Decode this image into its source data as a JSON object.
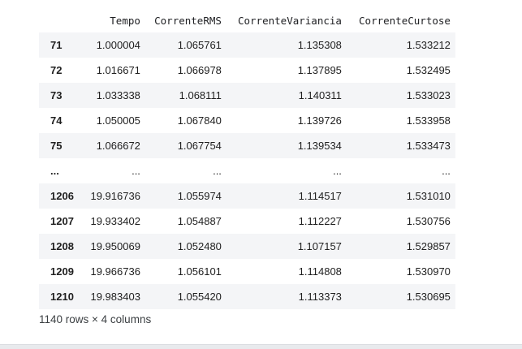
{
  "table": {
    "columns": [
      "Tempo",
      "CorrenteRMS",
      "CorrenteVariancia",
      "CorrenteCurtose"
    ],
    "rows": [
      {
        "index": "71",
        "values": [
          "1.000004",
          "1.065761",
          "1.135308",
          "1.533212"
        ]
      },
      {
        "index": "72",
        "values": [
          "1.016671",
          "1.066978",
          "1.137895",
          "1.532495"
        ]
      },
      {
        "index": "73",
        "values": [
          "1.033338",
          "1.068111",
          "1.140311",
          "1.533023"
        ]
      },
      {
        "index": "74",
        "values": [
          "1.050005",
          "1.067840",
          "1.139726",
          "1.533958"
        ]
      },
      {
        "index": "75",
        "values": [
          "1.066672",
          "1.067754",
          "1.139534",
          "1.533473"
        ]
      },
      {
        "index": "...",
        "values": [
          "...",
          "...",
          "...",
          "..."
        ]
      },
      {
        "index": "1206",
        "values": [
          "19.916736",
          "1.055974",
          "1.114517",
          "1.531010"
        ]
      },
      {
        "index": "1207",
        "values": [
          "19.933402",
          "1.054887",
          "1.112227",
          "1.530756"
        ]
      },
      {
        "index": "1208",
        "values": [
          "19.950069",
          "1.052480",
          "1.107157",
          "1.529857"
        ]
      },
      {
        "index": "1209",
        "values": [
          "19.966736",
          "1.056101",
          "1.114808",
          "1.530970"
        ]
      },
      {
        "index": "1210",
        "values": [
          "19.983403",
          "1.055420",
          "1.113373",
          "1.530695"
        ]
      }
    ]
  },
  "shape_text": "1140 rows × 4 columns"
}
